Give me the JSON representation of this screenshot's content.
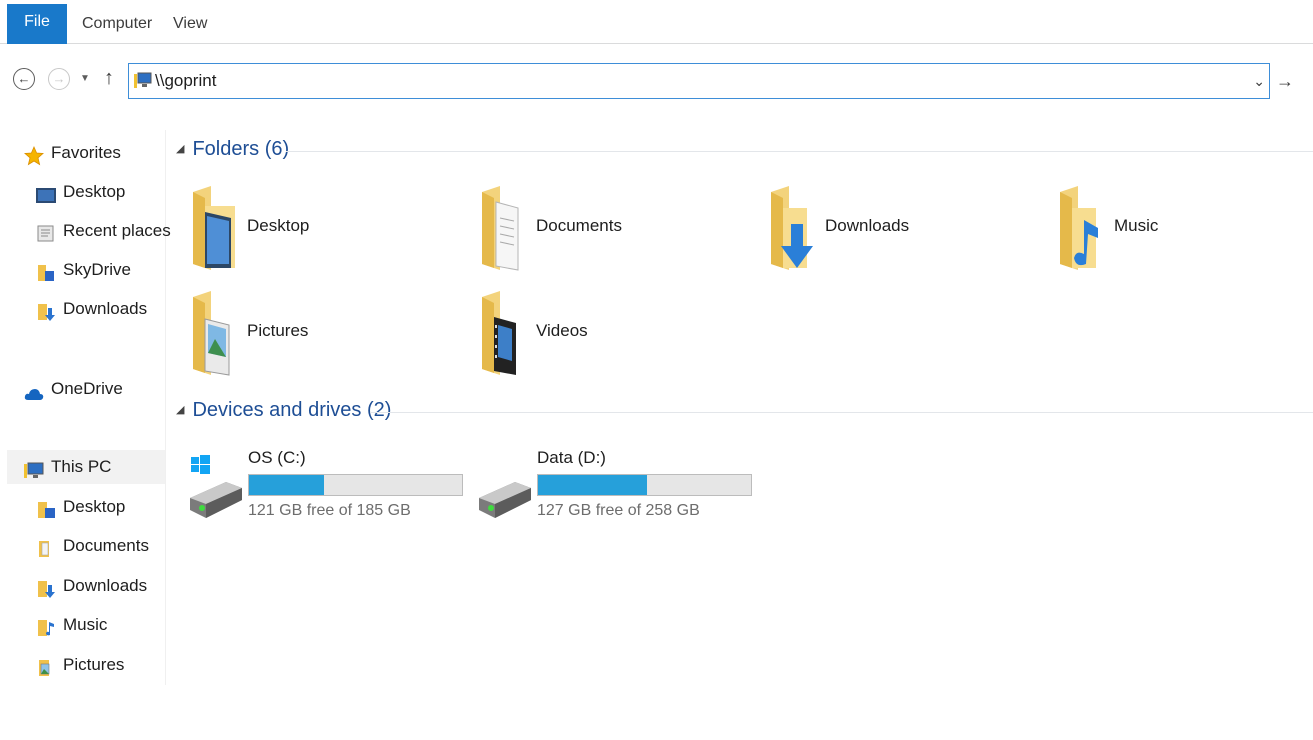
{
  "ribbon": {
    "tabs": [
      {
        "label": "File",
        "active": true
      },
      {
        "label": "Computer",
        "active": false
      },
      {
        "label": "View",
        "active": false
      }
    ]
  },
  "nav": {
    "back_icon": "←",
    "forward_icon": "→",
    "recent_icon": "▼",
    "up_icon": "↑"
  },
  "address": {
    "value": "\\\\goprint",
    "dropdown_icon": "⌄",
    "go_icon": "→"
  },
  "sidebar": {
    "favorites": {
      "header": "Favorites",
      "items": [
        {
          "label": "Desktop",
          "icon": "desktop-icon"
        },
        {
          "label": "Recent places",
          "icon": "recent-places-icon"
        },
        {
          "label": "SkyDrive",
          "icon": "skydrive-icon"
        },
        {
          "label": "Downloads",
          "icon": "downloads-icon"
        }
      ]
    },
    "onedrive": {
      "label": "OneDrive"
    },
    "thispc": {
      "header": "This PC",
      "items": [
        {
          "label": "Desktop"
        },
        {
          "label": "Documents"
        },
        {
          "label": "Downloads"
        },
        {
          "label": "Music"
        },
        {
          "label": "Pictures"
        }
      ]
    }
  },
  "content": {
    "folders_header": "Folders (6)",
    "folders": [
      {
        "label": "Desktop",
        "icon": "desktop-folder-icon"
      },
      {
        "label": "Documents",
        "icon": "documents-folder-icon"
      },
      {
        "label": "Downloads",
        "icon": "downloads-folder-icon"
      },
      {
        "label": "Music",
        "icon": "music-folder-icon"
      },
      {
        "label": "Pictures",
        "icon": "pictures-folder-icon"
      },
      {
        "label": "Videos",
        "icon": "videos-folder-icon"
      }
    ],
    "devices_header": "Devices and drives (2)",
    "drives": [
      {
        "name": "OS (C:)",
        "free": "121 GB free of 185 GB",
        "used_fraction": 0.35
      },
      {
        "name": "Data (D:)",
        "free": "127 GB free of 258 GB",
        "used_fraction": 0.51
      }
    ]
  },
  "colors": {
    "accent": "#1979ca",
    "drive_bar": "#26a0da",
    "header_text": "#1e4e95"
  }
}
